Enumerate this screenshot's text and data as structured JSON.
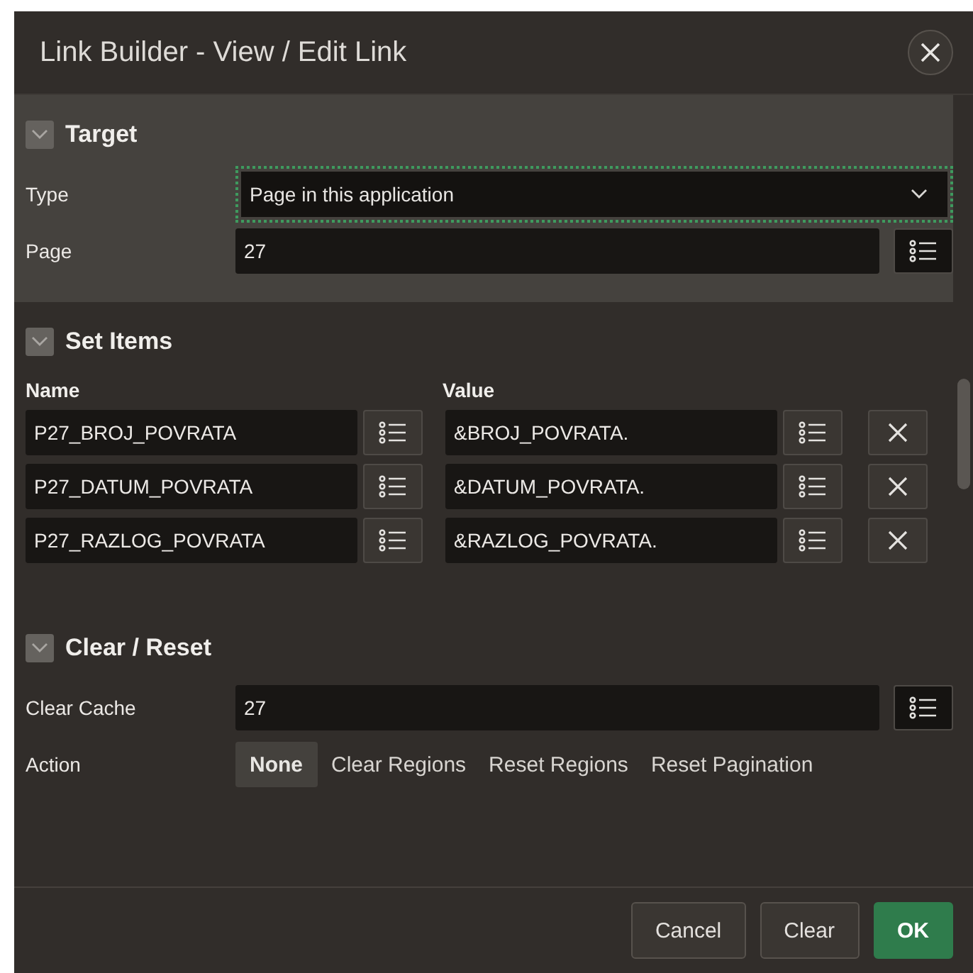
{
  "dialog": {
    "title": "Link Builder - View / Edit Link"
  },
  "target": {
    "title": "Target",
    "expanded": true,
    "type": {
      "label": "Type",
      "value": "Page in this application",
      "focused": true
    },
    "page": {
      "label": "Page",
      "value": "27"
    }
  },
  "set_items": {
    "title": "Set Items",
    "expanded": true,
    "columns": [
      "Name",
      "Value"
    ],
    "rows": [
      {
        "name": "P27_BROJ_POVRATA",
        "value": "&BROJ_POVRATA."
      },
      {
        "name": "P27_DATUM_POVRATA",
        "value": "&DATUM_POVRATA."
      },
      {
        "name": "P27_RAZLOG_POVRATA",
        "value": "&RAZLOG_POVRATA."
      }
    ]
  },
  "clear_reset": {
    "title": "Clear / Reset",
    "expanded": true,
    "clear_cache": {
      "label": "Clear Cache",
      "value": "27"
    },
    "action": {
      "label": "Action",
      "options": [
        {
          "label": "None",
          "selected": true
        },
        {
          "label": "Clear Regions",
          "selected": false
        },
        {
          "label": "Reset Regions",
          "selected": false
        },
        {
          "label": "Reset Pagination",
          "selected": false
        }
      ]
    }
  },
  "buttons": [
    {
      "label": "Cancel",
      "kind": "normal"
    },
    {
      "label": "Clear",
      "kind": "normal"
    },
    {
      "label": "OK",
      "kind": "primary"
    }
  ]
}
